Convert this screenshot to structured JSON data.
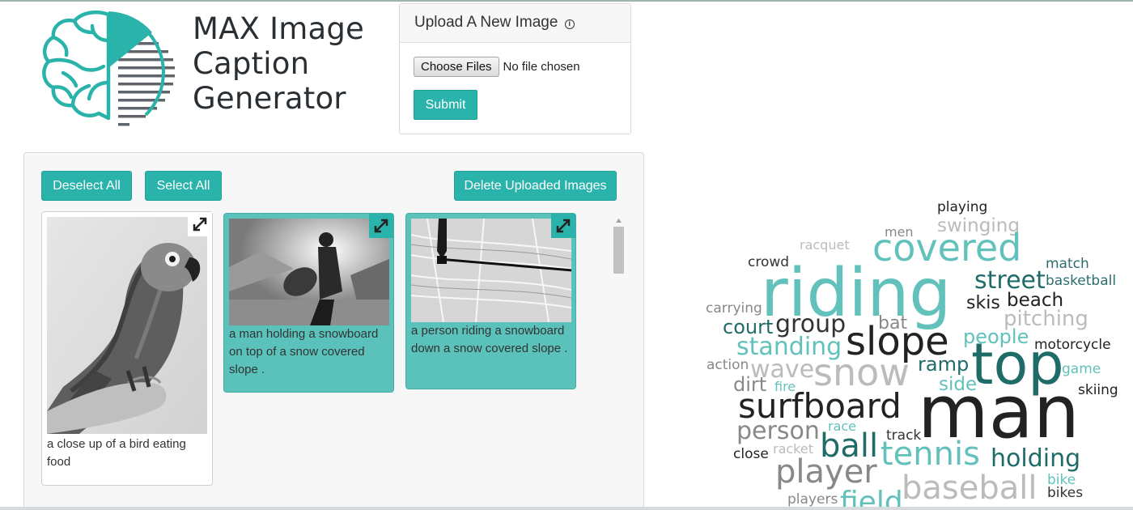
{
  "app": {
    "title_lines": [
      "MAX Image",
      "Caption",
      "Generator"
    ]
  },
  "upload": {
    "header": "Upload A New Image",
    "info_icon": "info-icon",
    "choose_label": "Choose Files",
    "file_status": "No file chosen",
    "submit_label": "Submit"
  },
  "gallery": {
    "deselect_label": "Deselect All",
    "select_label": "Select All",
    "delete_label": "Delete Uploaded Images",
    "images": [
      {
        "caption": "a close up of a bird eating food",
        "selected": false,
        "subject": "grey parrot perched on a hand"
      },
      {
        "caption": "a man holding a snowboard on top of a snow covered slope .",
        "selected": true,
        "subject": "snowboarder silhouette against the sun"
      },
      {
        "caption": "a person riding a snowboard down a snow covered slope .",
        "selected": true,
        "subject": "skier on snow with pole"
      }
    ]
  },
  "colors": {
    "accent": "#2ab3aa",
    "selected_card": "#5ac2bb",
    "logo_teal": "#2ab3aa",
    "logo_grey": "#5f656b"
  },
  "wordcloud": {
    "words": [
      {
        "text": "playing",
        "color": "#222222"
      },
      {
        "text": "men",
        "color": "#888888"
      },
      {
        "text": "swinging",
        "color": "#bbbbbb"
      },
      {
        "text": "racquet",
        "color": "#bbbbbb"
      },
      {
        "text": "covered",
        "color": "#62c2bb"
      },
      {
        "text": "crowd",
        "color": "#333333"
      },
      {
        "text": "riding",
        "color": "#62c2bb"
      },
      {
        "text": "match",
        "color": "#2b6e6b"
      },
      {
        "text": "street",
        "color": "#1f6b68"
      },
      {
        "text": "basketball",
        "color": "#2b6e6b"
      },
      {
        "text": "carrying",
        "color": "#888888"
      },
      {
        "text": "skis",
        "color": "#222222"
      },
      {
        "text": "beach",
        "color": "#222222"
      },
      {
        "text": "court",
        "color": "#1f6b68"
      },
      {
        "text": "group",
        "color": "#333333"
      },
      {
        "text": "bat",
        "color": "#888888"
      },
      {
        "text": "pitching",
        "color": "#bbbbbb"
      },
      {
        "text": "slope",
        "color": "#222222"
      },
      {
        "text": "people",
        "color": "#62c2bb"
      },
      {
        "text": "standing",
        "color": "#62c2bb"
      },
      {
        "text": "motorcycle",
        "color": "#222222"
      },
      {
        "text": "action",
        "color": "#888888"
      },
      {
        "text": "wave",
        "color": "#bbbbbb"
      },
      {
        "text": "snow",
        "color": "#bbbbbb"
      },
      {
        "text": "ramp",
        "color": "#1f6b68"
      },
      {
        "text": "top",
        "color": "#1f6b68"
      },
      {
        "text": "game",
        "color": "#62c2bb"
      },
      {
        "text": "dirt",
        "color": "#888888"
      },
      {
        "text": "fire",
        "color": "#62c2bb"
      },
      {
        "text": "side",
        "color": "#62c2bb"
      },
      {
        "text": "skiing",
        "color": "#222222"
      },
      {
        "text": "surfboard",
        "color": "#222222"
      },
      {
        "text": "man",
        "color": "#222222"
      },
      {
        "text": "person",
        "color": "#888888"
      },
      {
        "text": "race",
        "color": "#62c2bb"
      },
      {
        "text": "track",
        "color": "#333333"
      },
      {
        "text": "ball",
        "color": "#1f6b68"
      },
      {
        "text": "tennis",
        "color": "#62c2bb"
      },
      {
        "text": "holding",
        "color": "#1f6b68"
      },
      {
        "text": "close",
        "color": "#222222"
      },
      {
        "text": "racket",
        "color": "#bbbbbb"
      },
      {
        "text": "player",
        "color": "#888888"
      },
      {
        "text": "baseball",
        "color": "#bbbbbb"
      },
      {
        "text": "bike",
        "color": "#62c2bb"
      },
      {
        "text": "bikes",
        "color": "#333333"
      },
      {
        "text": "players",
        "color": "#888888"
      },
      {
        "text": "field",
        "color": "#62c2bb"
      }
    ]
  }
}
